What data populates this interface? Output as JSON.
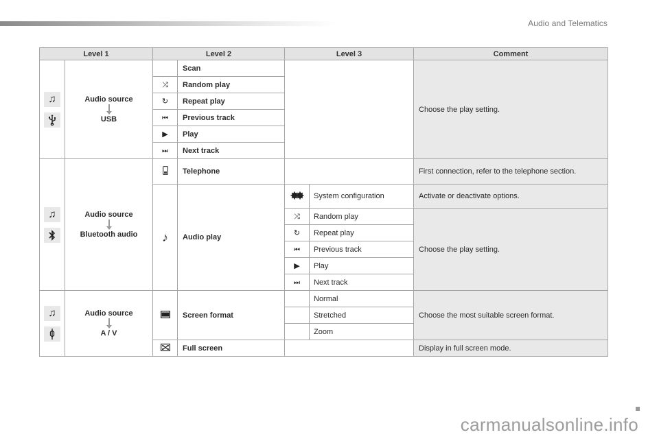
{
  "header": {
    "section_title": "Audio and Telematics"
  },
  "table": {
    "columns": [
      "Level 1",
      "Level 2",
      "Level 3",
      "Comment"
    ],
    "groups": [
      {
        "level1": {
          "icons": [
            "music-note-icon",
            "usb-icon"
          ],
          "source_label": "Audio source",
          "target_label": "USB"
        },
        "rows": [
          {
            "level2_icon": "",
            "level2": "Scan"
          },
          {
            "level2_icon": "shuffle-icon",
            "level2": "Random play"
          },
          {
            "level2_icon": "repeat-icon",
            "level2": "Repeat play"
          },
          {
            "level2_icon": "previous-track-icon",
            "level2": "Previous track"
          },
          {
            "level2_icon": "play-icon",
            "level2": "Play"
          },
          {
            "level2_icon": "next-track-icon",
            "level2": "Next track"
          }
        ],
        "comment": "Choose the play setting."
      },
      {
        "level1": {
          "icons": [
            "music-note-icon",
            "bluetooth-icon"
          ],
          "source_label": "Audio source",
          "target_label": "Bluetooth audio"
        },
        "telephone": {
          "level2_icon": "phone-icon",
          "level2": "Telephone",
          "comment": "First connection, refer to the telephone section."
        },
        "audio_play": {
          "level2_icon": "eighth-note-icon",
          "level2": "Audio play",
          "system_config": {
            "level3_icon": "gears-icon",
            "level3": "System configuration",
            "comment": "Activate or deactivate options."
          },
          "rows": [
            {
              "level3_icon": "shuffle-icon",
              "level3": "Random play"
            },
            {
              "level3_icon": "repeat-icon",
              "level3": "Repeat play"
            },
            {
              "level3_icon": "previous-track-icon",
              "level3": "Previous track"
            },
            {
              "level3_icon": "play-icon",
              "level3": "Play"
            },
            {
              "level3_icon": "next-track-icon",
              "level3": "Next track"
            }
          ],
          "comment": "Choose the play setting."
        }
      },
      {
        "level1": {
          "icons": [
            "music-note-icon",
            "av-jack-icon"
          ],
          "source_label": "Audio source",
          "target_label": "A / V"
        },
        "screen_format": {
          "level2_icon": "screen-format-icon",
          "level2": "Screen format",
          "options": [
            "Normal",
            "Stretched",
            "Zoom"
          ],
          "comment": "Choose the most suitable screen format."
        },
        "full_screen": {
          "level2_icon": "full-screen-icon",
          "level2": "Full screen",
          "comment": "Display in full screen mode."
        }
      }
    ]
  },
  "footer": {
    "watermark": "carmanualsonline.info"
  }
}
